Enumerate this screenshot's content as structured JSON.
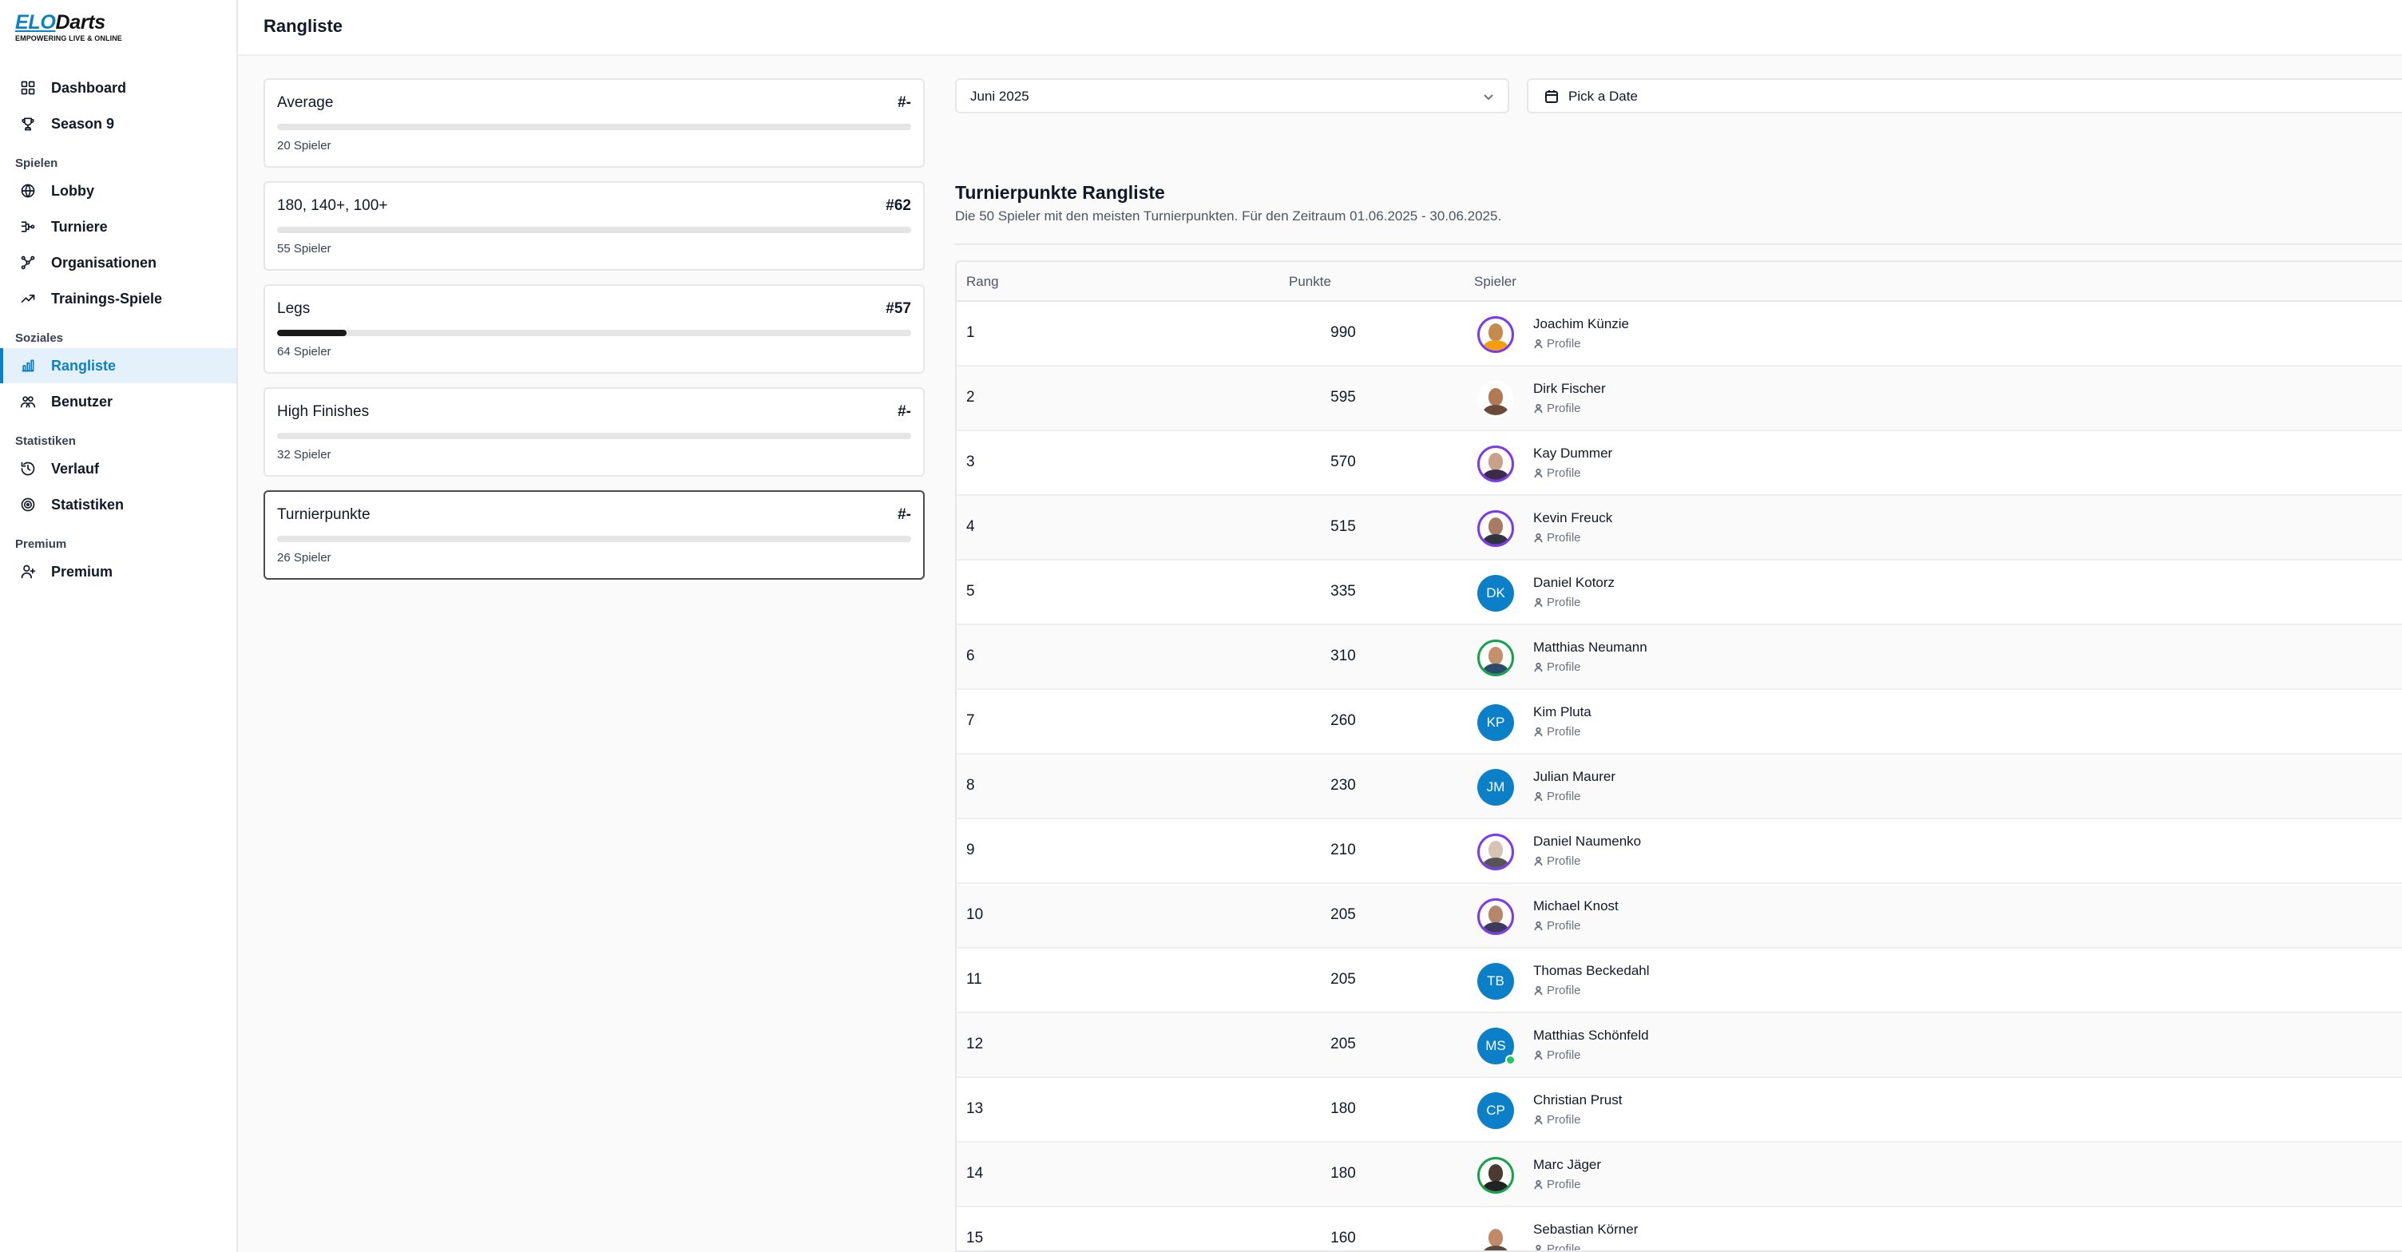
{
  "app": {
    "logo_elo": "ELO",
    "logo_darts": "Darts",
    "logo_tagline": "EMPOWERING LIVE & ONLINE"
  },
  "sidebar": {
    "top_items": [
      {
        "label": "Dashboard",
        "icon": "dashboard-icon"
      },
      {
        "label": "Season 9",
        "icon": "trophy-icon"
      }
    ],
    "sections": [
      {
        "title": "Spielen",
        "items": [
          {
            "label": "Lobby",
            "icon": "globe-icon"
          },
          {
            "label": "Turniere",
            "icon": "bracket-icon"
          },
          {
            "label": "Organisationen",
            "icon": "network-icon"
          },
          {
            "label": "Trainings-Spiele",
            "icon": "trending-up-icon"
          }
        ]
      },
      {
        "title": "Soziales",
        "items": [
          {
            "label": "Rangliste",
            "icon": "bar-chart-icon",
            "active": true
          },
          {
            "label": "Benutzer",
            "icon": "users-icon"
          }
        ]
      },
      {
        "title": "Statistiken",
        "items": [
          {
            "label": "Verlauf",
            "icon": "history-icon"
          },
          {
            "label": "Statistiken",
            "icon": "target-icon"
          }
        ]
      },
      {
        "title": "Premium",
        "items": [
          {
            "label": "Premium",
            "icon": "user-plus-icon"
          }
        ]
      }
    ]
  },
  "header": {
    "title": "Rangliste"
  },
  "categories": [
    {
      "name": "Average",
      "rank": "#-",
      "count": "20 Spieler",
      "progress": 0
    },
    {
      "name": "180, 140+, 100+",
      "rank": "#62",
      "count": "55 Spieler",
      "progress": 0
    },
    {
      "name": "Legs",
      "rank": "#57",
      "count": "64 Spieler",
      "progress": 0.11
    },
    {
      "name": "High Finishes",
      "rank": "#-",
      "count": "32 Spieler",
      "progress": 0
    },
    {
      "name": "Turnierpunkte",
      "rank": "#-",
      "count": "26 Spieler",
      "progress": 0,
      "selected": true
    }
  ],
  "filters": {
    "month_select": "Juni 2025",
    "date_button": "Pick a Date"
  },
  "ranking": {
    "title": "Turnierpunkte Rangliste",
    "description": "Die 50 Spieler mit den meisten Turnierpunkten. Für den Zeitraum 01.06.2025 - 30.06.2025.",
    "columns": {
      "rank": "Rang",
      "points": "Punkte",
      "player": "Spieler"
    },
    "profile_label": "Profile",
    "rows": [
      {
        "rank": "1",
        "points": "990",
        "name": "Joachim Künzie",
        "avatar": "photo",
        "face": "#c58a52",
        "shirt": "#f59e0b"
      },
      {
        "rank": "2",
        "points": "595",
        "name": "Dirk Fischer",
        "avatar": "photo-plain",
        "face": "#b07a56",
        "shirt": "#6b4a3a"
      },
      {
        "rank": "3",
        "points": "570",
        "name": "Kay Dummer",
        "avatar": "photo",
        "face": "#c9a08a",
        "shirt": "#3b2a4a"
      },
      {
        "rank": "4",
        "points": "515",
        "name": "Kevin Freuck",
        "avatar": "photo",
        "face": "#a77a62",
        "shirt": "#2f3340"
      },
      {
        "rank": "5",
        "points": "335",
        "name": "Daniel Kotorz",
        "avatar": "initials",
        "initials": "DK"
      },
      {
        "rank": "6",
        "points": "310",
        "name": "Matthias Neumann",
        "avatar": "photo-green",
        "face": "#c48f6a",
        "shirt": "#2a4a6a"
      },
      {
        "rank": "7",
        "points": "260",
        "name": "Kim Pluta",
        "avatar": "initials",
        "initials": "KP"
      },
      {
        "rank": "8",
        "points": "230",
        "name": "Julian Maurer",
        "avatar": "initials",
        "initials": "JM"
      },
      {
        "rank": "9",
        "points": "210",
        "name": "Daniel Naumenko",
        "avatar": "photo",
        "face": "#d8c2b4",
        "shirt": "#555555"
      },
      {
        "rank": "10",
        "points": "205",
        "name": "Michael Knost",
        "avatar": "photo",
        "face": "#b6866a",
        "shirt": "#3a3a5a"
      },
      {
        "rank": "11",
        "points": "205",
        "name": "Thomas Beckedahl",
        "avatar": "initials",
        "initials": "TB"
      },
      {
        "rank": "12",
        "points": "205",
        "name": "Matthias Schönfeld",
        "avatar": "initials",
        "initials": "MS",
        "online": true
      },
      {
        "rank": "13",
        "points": "180",
        "name": "Christian Prust",
        "avatar": "initials",
        "initials": "CP"
      },
      {
        "rank": "14",
        "points": "180",
        "name": "Marc Jäger",
        "avatar": "photo-green",
        "face": "#4a3a30",
        "shirt": "#222222"
      },
      {
        "rank": "15",
        "points": "160",
        "name": "Sebastian Körner",
        "avatar": "photo-plain",
        "face": "#c08a6a",
        "shirt": "#5a4a40"
      }
    ]
  }
}
